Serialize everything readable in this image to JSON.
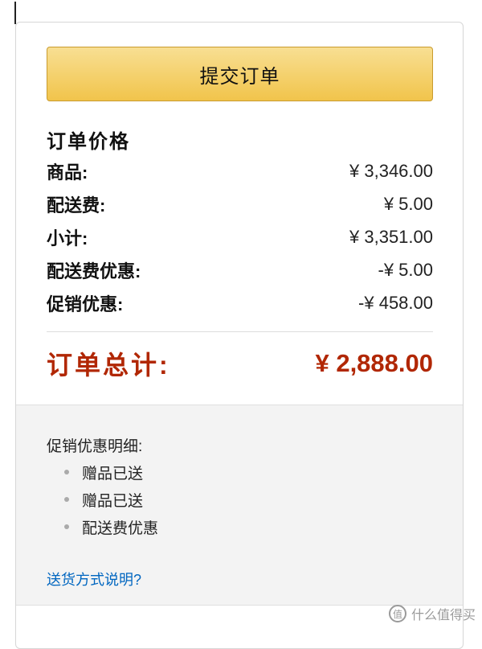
{
  "submit_button": {
    "label": "提交订单"
  },
  "summary": {
    "title": "订单价格",
    "rows": [
      {
        "label": "商品:",
        "value": "¥ 3,346.00"
      },
      {
        "label": "配送费:",
        "value": "¥ 5.00"
      },
      {
        "label": "小计:",
        "value": "¥ 3,351.00"
      },
      {
        "label": "配送费优惠:",
        "value": "-¥ 5.00"
      },
      {
        "label": "促销优惠:",
        "value": "-¥ 458.00"
      }
    ]
  },
  "total": {
    "label": "订单总计:",
    "value": "¥ 2,888.00"
  },
  "promotions": {
    "title": "促销优惠明细:",
    "items": [
      "赠品已送",
      "赠品已送",
      "配送费优惠"
    ],
    "shipping_link": "送货方式说明?"
  },
  "watermark": {
    "icon_text": "值",
    "text": "什么值得买"
  },
  "colors": {
    "total": "#b12704",
    "link": "#0066c0",
    "button": "#f1c44b"
  }
}
